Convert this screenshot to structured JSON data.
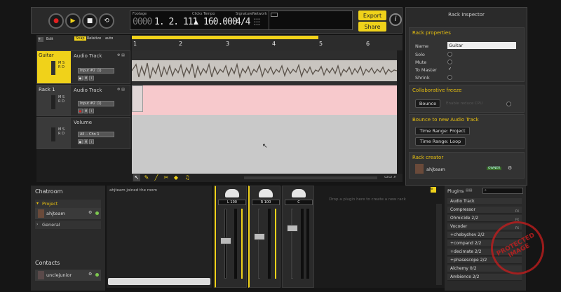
{
  "transport": {
    "lcd": {
      "footage_label": "Footage",
      "footage": "0000",
      "position": "1. 2. 111",
      "clicks_label": "Clicks",
      "tempo_label": "Tempo",
      "tempo": "160.000",
      "signature_label": "Signature",
      "signature": "4/4",
      "metronome_label": "Network"
    },
    "export_label": "Export",
    "share_label": "Share"
  },
  "tracks": {
    "edit_label": "Edit",
    "snap_label": "Snap",
    "relative_label": "Relative",
    "snap_value": "auto",
    "bars": [
      "1",
      "2",
      "3",
      "4",
      "5",
      "6"
    ],
    "items": [
      {
        "name": "Guitar",
        "type": "Audio Track",
        "input": "Input #2 (1)"
      },
      {
        "name": "Rack 1",
        "type": "Audio Track",
        "input": "Input #2 (1)"
      },
      {
        "name": "",
        "type": "Volume",
        "input": "All -- Chn 1"
      }
    ]
  },
  "inspector": {
    "title": "Rack Inspector",
    "properties_title": "Rack properties",
    "name_label": "Name",
    "name_value": "Guitar",
    "solo_label": "Solo",
    "mute_label": "Mute",
    "to_master_label": "To Master",
    "to_master_check": "✓",
    "shrink_label": "Shrink",
    "freeze_title": "Collaborative freeze",
    "bounce_label": "Bounce",
    "reduce_cpu_label": "Enable reduce CPU",
    "bounce_new_title": "Bounce to new Audio Track",
    "range_project": "Time Range: Project",
    "range_loop": "Time Range: Loop",
    "creator_title": "Rack creator",
    "creator_name": "ahjteam",
    "owner_badge": "OWNER"
  },
  "chat": {
    "title": "Chatroom",
    "project_label": "Project",
    "user": "ahjteam",
    "general_label": "General",
    "contacts_title": "Contacts",
    "contact": "unclejunior",
    "log_message": "ahjteam joined the room"
  },
  "mixer": {
    "pans": [
      "L 100",
      "R 100",
      "C"
    ],
    "drop_hint": "Drop a plugin here to create a new rack"
  },
  "plugins": {
    "title": "Plugins",
    "items": [
      "Audio Track",
      "Compressor",
      "Ohmicide 2/2",
      "Vocoder",
      "+chebyshev 2/2",
      "+compand 2/2",
      "+decimate 2/2",
      "+phasescope 2/2",
      "Alchemy 0/2",
      "Ambience 2/2"
    ]
  },
  "watermark": "PROTECTED IMAGE"
}
